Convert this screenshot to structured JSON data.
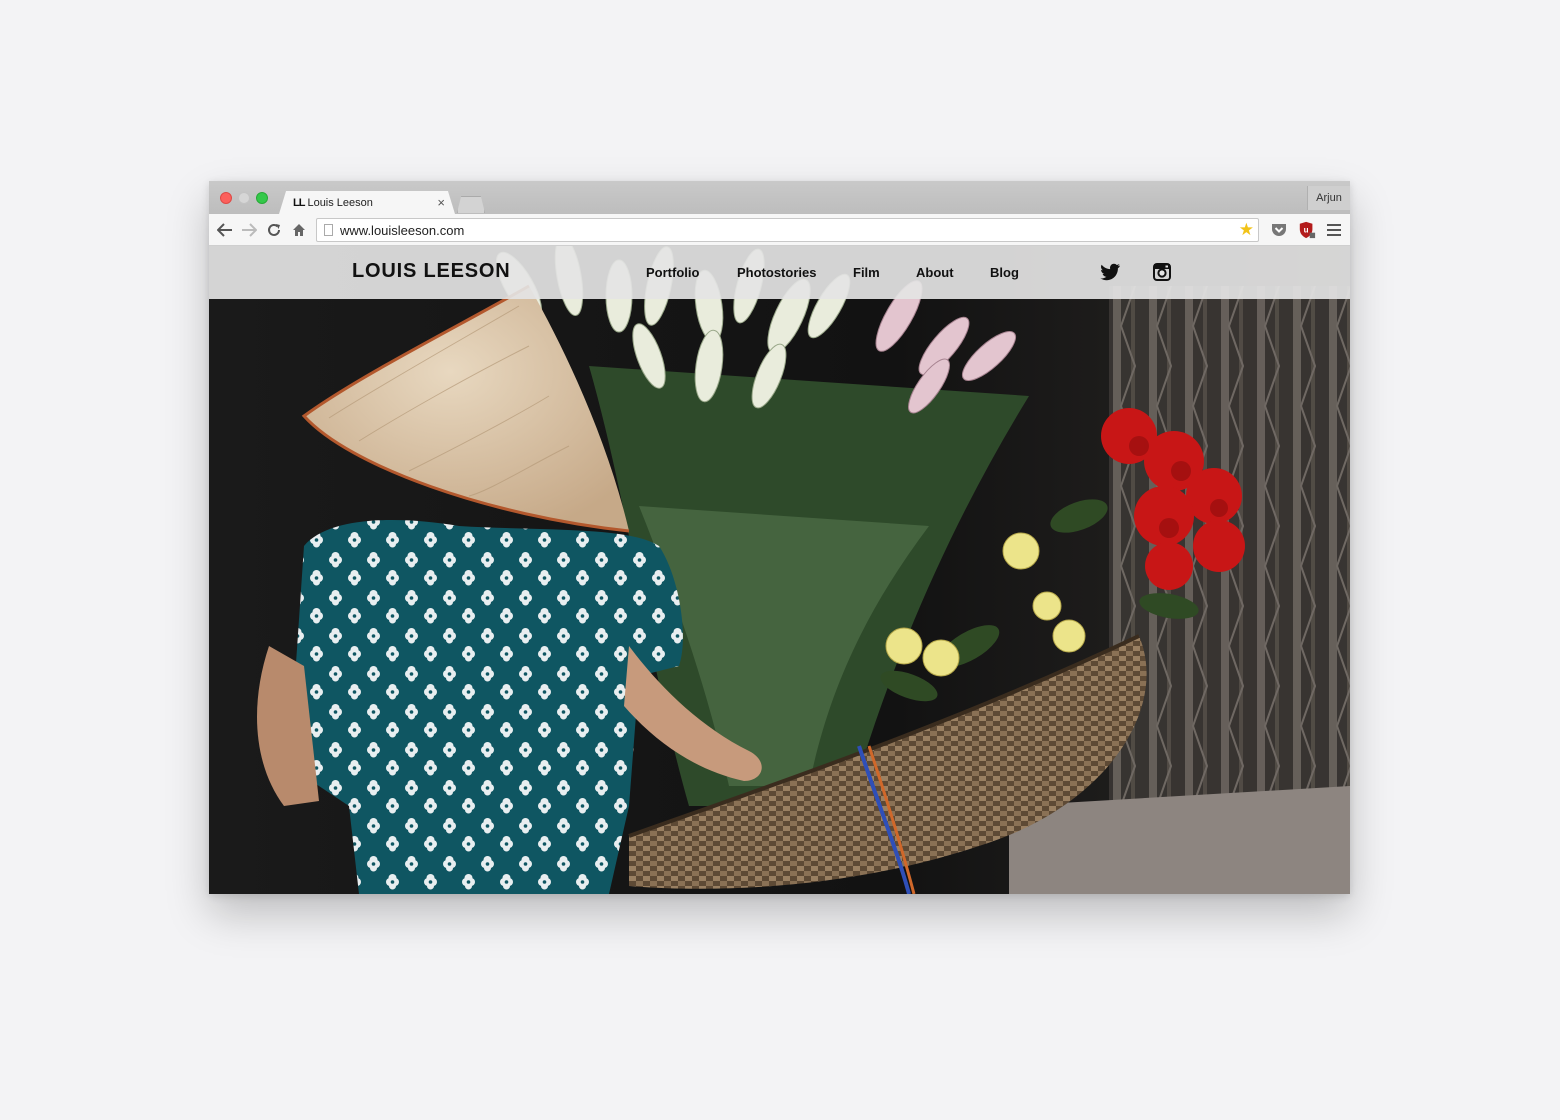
{
  "browser": {
    "tab_favicon": "LL",
    "tab_title": "Louis Leeson",
    "tab_close": "×",
    "profile_name": "Arjun",
    "url": "www.louisleeson.com",
    "icons": [
      "back-arrow-icon",
      "forward-arrow-icon",
      "reload-icon",
      "home-icon",
      "bookmark-star-icon",
      "pocket-icon",
      "ublock-icon",
      "menu-icon"
    ]
  },
  "site": {
    "logo": "LOUIS LEESON",
    "nav": [
      {
        "label": "Portfolio"
      },
      {
        "label": "Photostories"
      },
      {
        "label": "Film"
      },
      {
        "label": "About"
      },
      {
        "label": "Blog"
      }
    ],
    "social_icons": [
      "twitter-icon",
      "instagram-icon"
    ]
  },
  "colors": {
    "page_bg": "#f3f3f5",
    "nav_bg": "#e4e4e4",
    "traffic_red": "#fc605c",
    "traffic_green": "#34c84a",
    "star": "#f2c318"
  }
}
